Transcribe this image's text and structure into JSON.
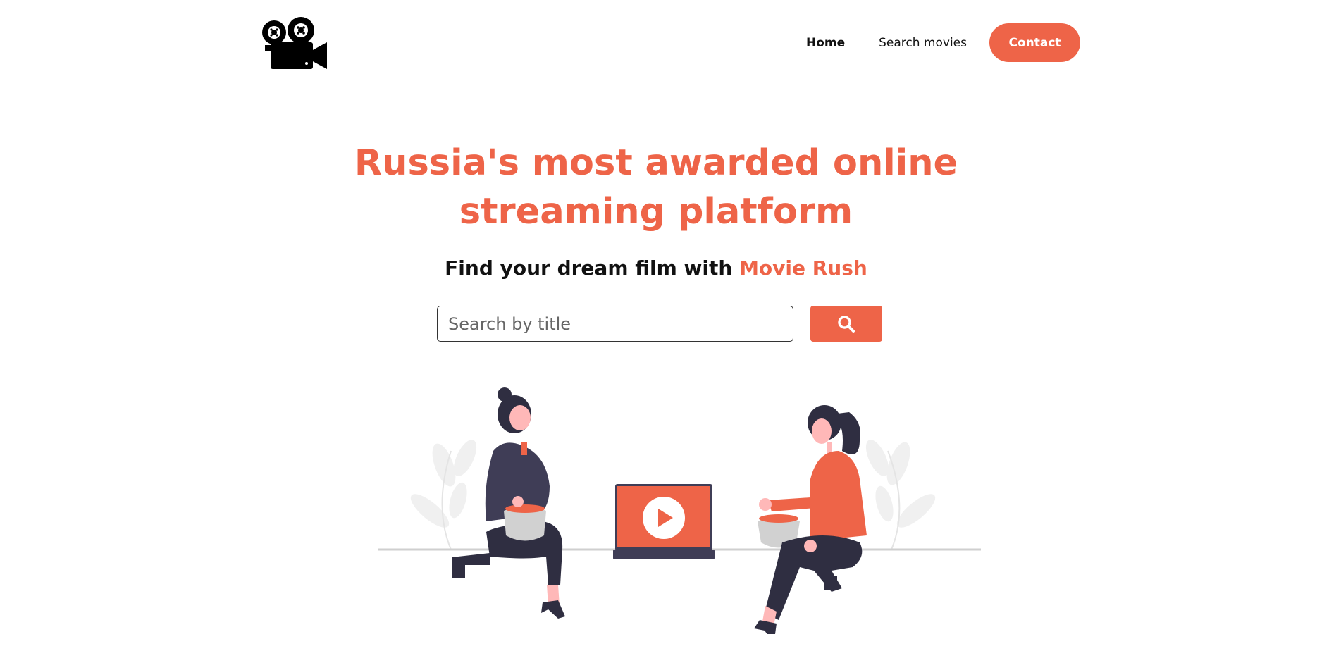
{
  "header": {
    "logo_icon": "movie-camera-icon",
    "nav": {
      "home_label": "Home",
      "search_label": "Search movies",
      "contact_label": "Contact"
    }
  },
  "hero": {
    "title_line1": "Russia's most awarded online",
    "title_line2": "streaming platform",
    "subtitle_prefix": "Find your dream film with",
    "subtitle_brand": "Movie Rush"
  },
  "search": {
    "placeholder": "Search by title",
    "value": "",
    "button_icon": "search-icon"
  },
  "illustration": {
    "name": "people-watching-laptop-illustration",
    "play_icon": "play-icon"
  },
  "colors": {
    "accent": "#ee6448",
    "dark": "#3f3d56",
    "text": "#111111"
  }
}
